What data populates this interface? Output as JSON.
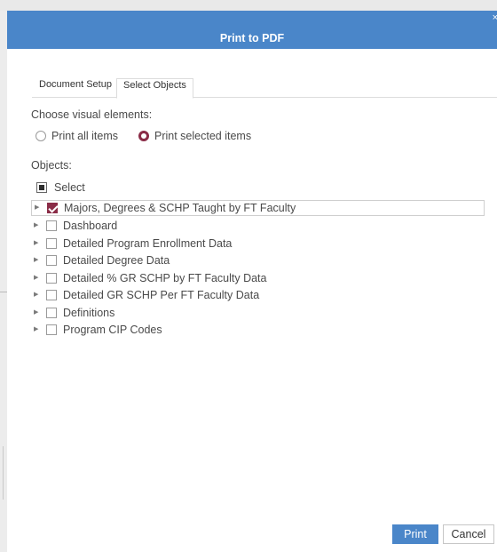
{
  "dialog": {
    "title": "Print to PDF",
    "close_glyph": "×"
  },
  "tabs": [
    {
      "label": "Document Setup",
      "active": false
    },
    {
      "label": "Select Objects",
      "active": true
    }
  ],
  "visual_elements": {
    "label": "Choose visual elements:",
    "options": [
      {
        "label": "Print all items",
        "selected": false
      },
      {
        "label": "Print selected items",
        "selected": true
      }
    ]
  },
  "objects": {
    "label": "Objects:",
    "select_all_label": "Select",
    "items": [
      {
        "label": "Majors, Degrees & SCHP Taught by FT Faculty",
        "checked": true
      },
      {
        "label": "Dashboard",
        "checked": false
      },
      {
        "label": "Detailed Program Enrollment Data",
        "checked": false
      },
      {
        "label": "Detailed Degree Data",
        "checked": false
      },
      {
        "label": "Detailed % GR SCHP by FT Faculty Data",
        "checked": false
      },
      {
        "label": "Detailed GR SCHP Per FT Faculty Data",
        "checked": false
      },
      {
        "label": "Definitions",
        "checked": false
      },
      {
        "label": "Program CIP Codes",
        "checked": false
      }
    ]
  },
  "buttons": {
    "print_label": "Print",
    "cancel_label": "Cancel"
  },
  "colors": {
    "header": "#4a86c9",
    "accent": "#8a2c47"
  }
}
